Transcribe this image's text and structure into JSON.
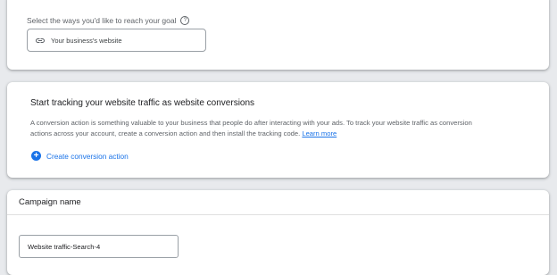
{
  "reach_card": {
    "label": "Select the ways you'd like to reach your goal",
    "help_icon": "help-circle-icon",
    "website_option": {
      "icon": "link-icon",
      "label": "Your business's website"
    }
  },
  "tracking_card": {
    "title": "Start tracking your website traffic as website conversions",
    "description": "A conversion action is something valuable to your business that people do after interacting with your ads. To track your website traffic as conversion actions across your account, create a conversion action and then install the tracking code.",
    "learn_more": "Learn more",
    "create_action": {
      "icon": "add-circle-icon",
      "label": "Create conversion action"
    }
  },
  "campaign_card": {
    "title": "Campaign name",
    "name_value": "Website traffic-Search-4"
  },
  "colors": {
    "accent": "#1a73e8",
    "background": "#e8eaed",
    "card": "#ffffff"
  }
}
